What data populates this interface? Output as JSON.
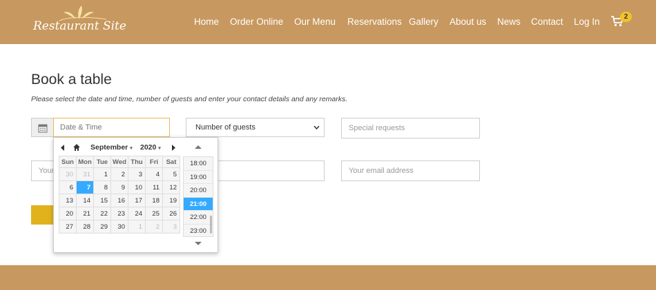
{
  "header": {
    "logo_text": "Restaurant Site",
    "nav": [
      {
        "label": "Home"
      },
      {
        "label": "Order Online"
      },
      {
        "label": "Our Menu"
      },
      {
        "label": "Reservations"
      },
      {
        "label": "Gallery"
      },
      {
        "label": "About us"
      },
      {
        "label": "News"
      },
      {
        "label": "Contact"
      },
      {
        "label": "Log In"
      }
    ],
    "cart_icon": "cart-icon",
    "cart_count": "2"
  },
  "page": {
    "title": "Book a table",
    "subtitle": "Please select the date and time, number of guests and enter your contact details and any remarks."
  },
  "form": {
    "datetime_placeholder": "Date & Time",
    "datetime_icon": "calendar-icon",
    "guests_value": "Number of guests",
    "special_requests_placeholder": "Special requests",
    "name_placeholder": "Your",
    "email_placeholder": "Your email address"
  },
  "picker": {
    "month": "September",
    "year": "2020",
    "weekdays": [
      "Sun",
      "Mon",
      "Tue",
      "Wed",
      "Thu",
      "Fri",
      "Sat"
    ],
    "weeks": [
      [
        "30",
        "31",
        "1",
        "2",
        "3",
        "4",
        "5"
      ],
      [
        "6",
        "7",
        "8",
        "9",
        "10",
        "11",
        "12"
      ],
      [
        "13",
        "14",
        "15",
        "16",
        "17",
        "18",
        "19"
      ],
      [
        "20",
        "21",
        "22",
        "23",
        "24",
        "25",
        "26"
      ],
      [
        "27",
        "28",
        "29",
        "30",
        "1",
        "2",
        "3"
      ]
    ],
    "selected_day": "7",
    "times": [
      "18:00",
      "19:00",
      "20:00",
      "21:00",
      "22:00",
      "23:00"
    ],
    "selected_time": "21:00"
  },
  "colors": {
    "brand": "#c7985f",
    "accent": "#e2b21c",
    "selection": "#33aaff",
    "badge": "#f0c22b"
  }
}
